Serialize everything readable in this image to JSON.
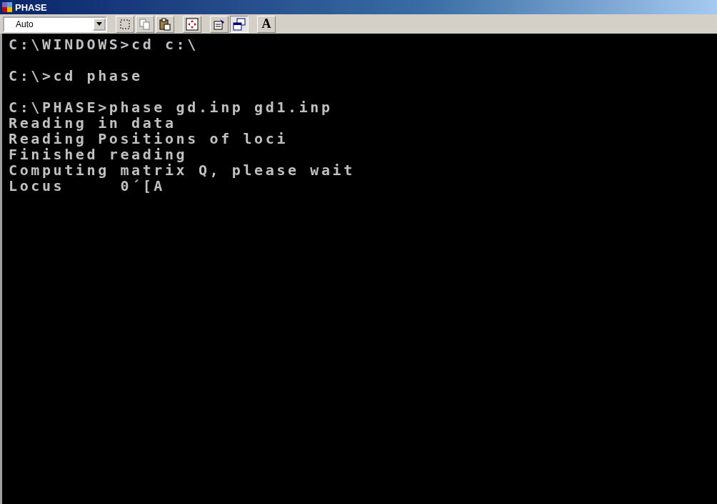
{
  "window": {
    "title": "PHASE"
  },
  "toolbar": {
    "font_size": "Auto",
    "buttons": [
      {
        "kind": "mark",
        "pressed": false
      },
      {
        "kind": "copy",
        "pressed": false
      },
      {
        "kind": "paste",
        "pressed": false
      },
      {
        "kind": "fullscreen",
        "pressed": false
      },
      {
        "kind": "properties",
        "pressed": false
      },
      {
        "kind": "background",
        "pressed": true
      },
      {
        "kind": "font",
        "label": "A",
        "pressed": false
      }
    ]
  },
  "console": {
    "blocks": [
      [
        "C:\\WINDOWS>cd c:\\"
      ],
      [
        "C:\\>cd phase"
      ],
      [
        "C:\\PHASE>phase gd.inp gd1.inp",
        "Reading in data",
        "Reading Positions of loci",
        "Finished reading",
        "Computing matrix Q, please wait",
        "Locus     0´[A"
      ]
    ]
  }
}
